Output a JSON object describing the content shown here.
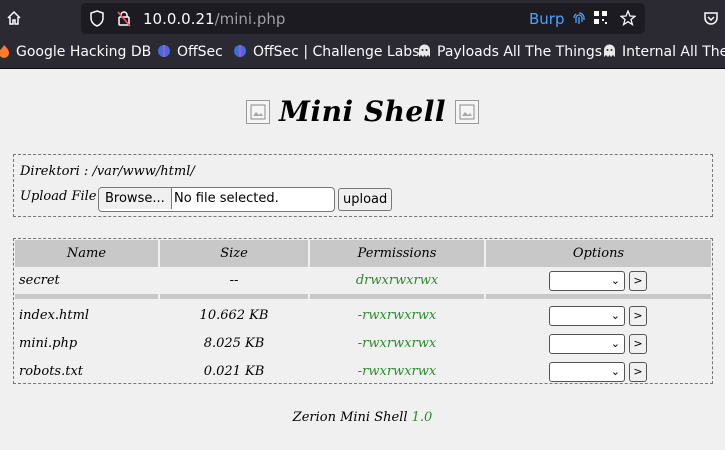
{
  "browser": {
    "url_host": "10.0.0.21",
    "url_path": "/mini.php",
    "proxy_label": "Burp",
    "bookmarks": [
      {
        "label": "Google Hacking DB",
        "icon": "flame-icon"
      },
      {
        "label": "OffSec",
        "icon": "offsec-icon"
      },
      {
        "label": "OffSec | Challenge Labs",
        "icon": "offsec-icon"
      },
      {
        "label": "Payloads All The Things",
        "icon": "ghost-icon"
      },
      {
        "label": "Internal All The",
        "icon": "ghost-icon"
      }
    ]
  },
  "page": {
    "title": "Mini Shell",
    "directory_label": "Direktori :",
    "directory_path": "/var/www/html/",
    "upload_label": "Upload File :",
    "browse_label": "Browse...",
    "file_status": "No file selected.",
    "upload_button": "upload",
    "table": {
      "headers": [
        "Name",
        "Size",
        "Permissions",
        "Options"
      ],
      "rows": [
        {
          "name": "secret",
          "size": "--",
          "permissions": "drwxrwxrwx"
        },
        {
          "name": "index.html",
          "size": "10.662 KB",
          "permissions": "-rwxrwxrwx"
        },
        {
          "name": "mini.php",
          "size": "8.025 KB",
          "permissions": "-rwxrwxrwx"
        },
        {
          "name": "robots.txt",
          "size": "0.021 KB",
          "permissions": "-rwxrwxrwx"
        }
      ],
      "go_label": ">"
    },
    "footer_text": "Zerion Mini Shell",
    "footer_version": "1.0"
  },
  "colors": {
    "permission_text": "#2e8b2e",
    "header_bg": "#c8c8c8",
    "toolbar_bg": "#2b2a33"
  }
}
